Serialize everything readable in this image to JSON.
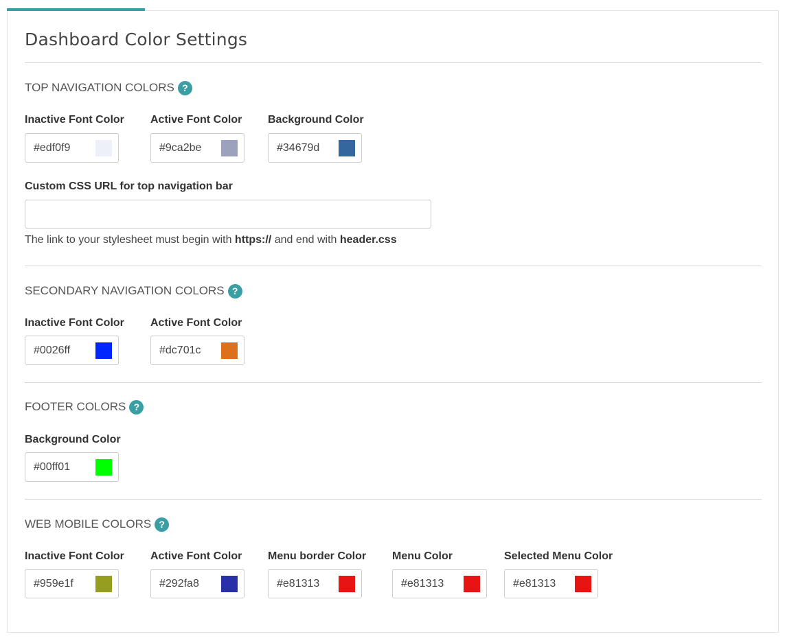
{
  "page": {
    "title": "Dashboard Color Settings"
  },
  "colors": {
    "accent": "#3a9ea5"
  },
  "sections": {
    "top_nav": {
      "title": "TOP NAVIGATION COLORS",
      "fields": [
        {
          "label": "Inactive Font Color",
          "value": "#edf0f9",
          "swatch": "#edf0f9"
        },
        {
          "label": "Active Font Color",
          "value": "#9ca2be",
          "swatch": "#9ca2be"
        },
        {
          "label": "Background Color",
          "value": "#34679d",
          "swatch": "#34679d"
        }
      ],
      "custom_css": {
        "label": "Custom CSS URL for top navigation bar",
        "value": "",
        "placeholder": "",
        "help_prefix": "The link to your stylesheet must begin with ",
        "help_bold1": "https://",
        "help_middle": " and end with ",
        "help_bold2": "header.css"
      }
    },
    "secondary_nav": {
      "title": "SECONDARY NAVIGATION COLORS",
      "fields": [
        {
          "label": "Inactive Font Color",
          "value": "#0026ff",
          "swatch": "#0026ff"
        },
        {
          "label": "Active Font Color",
          "value": "#dc701c",
          "swatch": "#dc701c"
        }
      ]
    },
    "footer": {
      "title": "FOOTER COLORS",
      "fields": [
        {
          "label": "Background Color",
          "value": "#00ff01",
          "swatch": "#00ff01"
        }
      ]
    },
    "web_mobile": {
      "title": "WEB MOBILE COLORS",
      "fields": [
        {
          "label": "Inactive Font Color",
          "value": "#959e1f",
          "swatch": "#959e1f"
        },
        {
          "label": "Active Font Color",
          "value": "#292fa8",
          "swatch": "#292fa8"
        },
        {
          "label": "Menu border Color",
          "value": "#e81313",
          "swatch": "#e81313"
        },
        {
          "label": "Menu Color",
          "value": "#e81313",
          "swatch": "#e81313"
        },
        {
          "label": "Selected Menu Color",
          "value": "#e81313",
          "swatch": "#e81313"
        }
      ]
    }
  },
  "icons": {
    "help": "question-circle-icon",
    "help_glyph": "?"
  }
}
